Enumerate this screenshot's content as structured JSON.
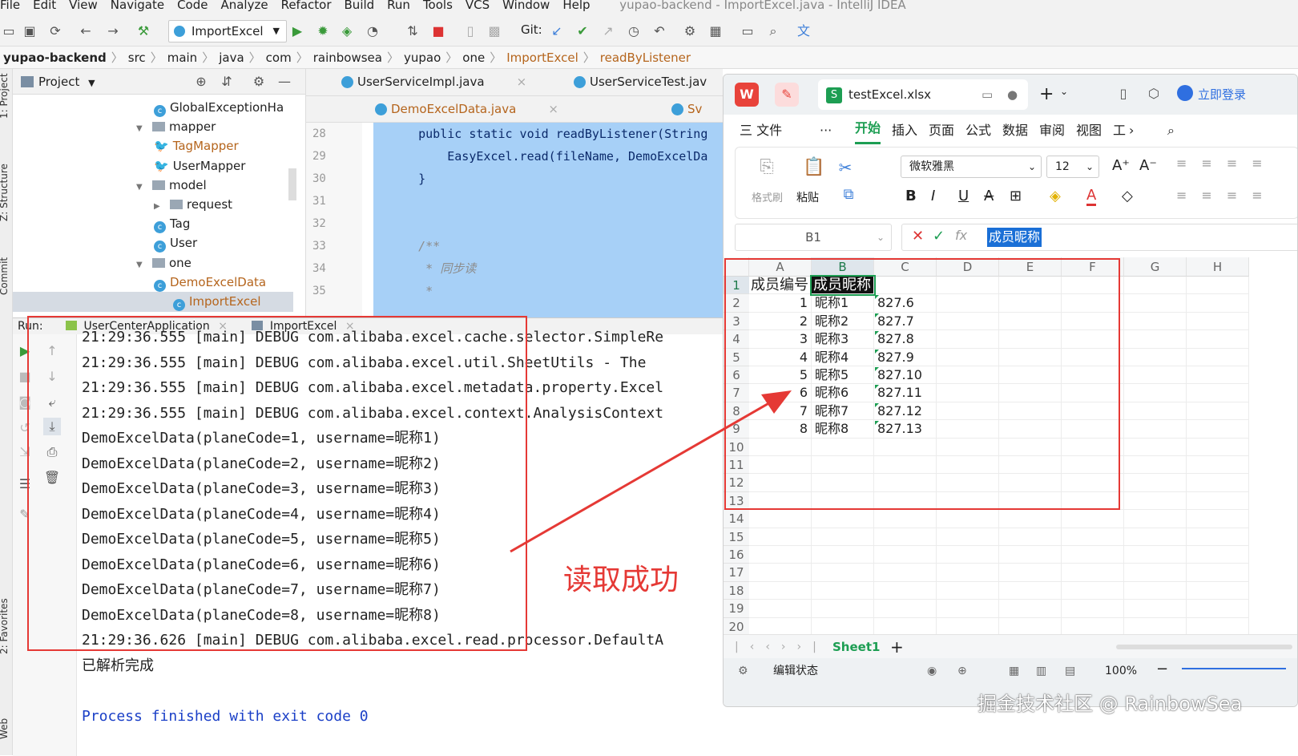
{
  "ide": {
    "menu": [
      "File",
      "Edit",
      "View",
      "Navigate",
      "Code",
      "Analyze",
      "Refactor",
      "Build",
      "Run",
      "Tools",
      "VCS",
      "Window",
      "Help"
    ],
    "window_title": "yupao-backend - ImportExcel.java - IntelliJ IDEA",
    "run_config": "ImportExcel",
    "git_label": "Git:",
    "breadcrumb": [
      "yupao-backend",
      "src",
      "main",
      "java",
      "com",
      "rainbowsea",
      "yupao",
      "one",
      "ImportExcel",
      "readByListener"
    ],
    "side_labels": {
      "project": "1: Project",
      "structure": "Z: Structure",
      "commit": "Commit",
      "favorites": "2: Favorites",
      "web": "Web"
    },
    "project_panel": {
      "title": "Project",
      "items": [
        {
          "label": "GlobalExceptionHa",
          "type": "class",
          "indent": 3
        },
        {
          "label": "mapper",
          "type": "folder",
          "indent": 2,
          "expanded": true
        },
        {
          "label": "TagMapper",
          "type": "mapper",
          "indent": 3
        },
        {
          "label": "UserMapper",
          "type": "mapper",
          "indent": 3
        },
        {
          "label": "model",
          "type": "folder",
          "indent": 2,
          "expanded": true
        },
        {
          "label": "request",
          "type": "folder",
          "indent": 3,
          "expanded": false
        },
        {
          "label": "Tag",
          "type": "class",
          "indent": 3
        },
        {
          "label": "User",
          "type": "class",
          "indent": 3
        },
        {
          "label": "one",
          "type": "folder",
          "indent": 2,
          "expanded": true
        },
        {
          "label": "DemoExcelData",
          "type": "class",
          "indent": 3
        },
        {
          "label": "ImportExcel",
          "type": "class",
          "indent": 3,
          "selected": true
        }
      ]
    },
    "editor_tabs_row1": [
      "UserServiceImpl.java",
      "UserServiceTest.jav"
    ],
    "editor_tabs_row2": [
      "DemoExcelData.java",
      "Sv"
    ],
    "line_numbers": [
      "28",
      "29",
      "30",
      "31",
      "32",
      "33",
      "34",
      "35"
    ],
    "code_lines": [
      "    public static void readByListener(String",
      "        EasyExcel.read(fileName, DemoExcelDa",
      "    }",
      "",
      "",
      "    /**",
      "     * 同步读",
      "     *"
    ],
    "run_panel": {
      "label": "Run:",
      "tabs": [
        "UserCenterApplication",
        "ImportExcel"
      ],
      "console": [
        "21:29:36.555 [main] DEBUG com.alibaba.excel.cache.selector.SimpleRe",
        "21:29:36.555 [main] DEBUG com.alibaba.excel.util.SheetUtils - The",
        "21:29:36.555 [main] DEBUG com.alibaba.excel.metadata.property.Excel",
        "21:29:36.555 [main] DEBUG com.alibaba.excel.context.AnalysisContext",
        "DemoExcelData(planeCode=1, username=昵称1)",
        "DemoExcelData(planeCode=2, username=昵称2)",
        "DemoExcelData(planeCode=3, username=昵称3)",
        "DemoExcelData(planeCode=4, username=昵称4)",
        "DemoExcelData(planeCode=5, username=昵称5)",
        "DemoExcelData(planeCode=6, username=昵称6)",
        "DemoExcelData(planeCode=7, username=昵称7)",
        "DemoExcelData(planeCode=8, username=昵称8)",
        "21:29:36.626 [main] DEBUG com.alibaba.excel.read.processor.DefaultA",
        "已解析完成",
        "",
        "Process finished with exit code 0"
      ]
    }
  },
  "wps": {
    "file_tab": "testExcel.xlsx",
    "login": "立即登录",
    "menu": [
      "三 文件",
      "···",
      "开始",
      "插入",
      "页面",
      "公式",
      "数据",
      "审阅",
      "视图",
      "工"
    ],
    "active_menu": "开始",
    "ribbon": {
      "format_painter": "格式刷",
      "paste": "粘贴",
      "font": "微软雅黑",
      "size": "12"
    },
    "name_box": "B1",
    "formula_value": "成员昵称",
    "columns": [
      "A",
      "B",
      "C",
      "D",
      "E",
      "F",
      "G",
      "H"
    ],
    "rows": [
      "1",
      "2",
      "3",
      "4",
      "5",
      "6",
      "7",
      "8",
      "9",
      "10",
      "11",
      "12",
      "13",
      "14",
      "15",
      "16",
      "17",
      "18",
      "19",
      "20"
    ],
    "cells": [
      [
        "成员编号",
        "成员昵称",
        ""
      ],
      [
        "1",
        "昵称1",
        "827.6"
      ],
      [
        "2",
        "昵称2",
        "827.7"
      ],
      [
        "3",
        "昵称3",
        "827.8"
      ],
      [
        "4",
        "昵称4",
        "827.9"
      ],
      [
        "5",
        "昵称5",
        "827.10"
      ],
      [
        "6",
        "昵称6",
        "827.11"
      ],
      [
        "7",
        "昵称7",
        "827.12"
      ],
      [
        "8",
        "昵称8",
        "827.13"
      ]
    ],
    "sheet_tab": "Sheet1",
    "status": "编辑状态",
    "zoom": "100%"
  },
  "annotation": {
    "label": "读取成功",
    "color": "#e53935"
  },
  "watermark": "掘金技术社区 @ RainbowSea"
}
